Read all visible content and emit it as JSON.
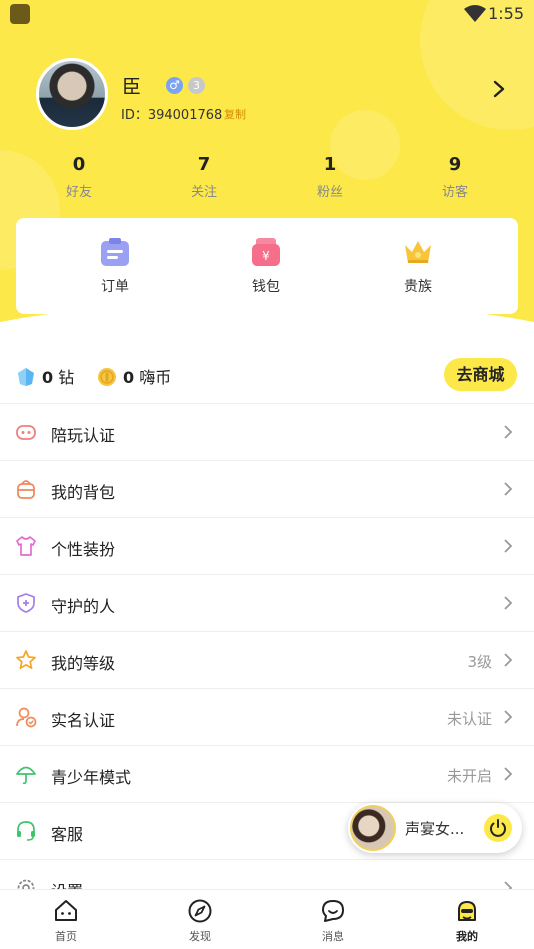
{
  "status_bar": {
    "time": "1:55"
  },
  "profile": {
    "name": "臣",
    "gender_symbol": "♂",
    "level_badge": "3",
    "id_text": "ID：394001768",
    "copy_label": "复制"
  },
  "stats": [
    {
      "value": "0",
      "label": "好友"
    },
    {
      "value": "7",
      "label": "关注"
    },
    {
      "value": "1",
      "label": "粉丝"
    },
    {
      "value": "9",
      "label": "访客"
    }
  ],
  "quick_actions": [
    {
      "label": "订单",
      "icon": "order-icon"
    },
    {
      "label": "钱包",
      "icon": "wallet-icon"
    },
    {
      "label": "贵族",
      "icon": "crown-icon"
    }
  ],
  "currency": {
    "diamond_value": "0",
    "diamond_unit": "钻",
    "coin_value": "0",
    "coin_unit": "嗨币",
    "shop_button": "去商城"
  },
  "menu": [
    {
      "label": "陪玩认证",
      "value": "",
      "icon": "game-partner-icon"
    },
    {
      "label": "我的背包",
      "value": "",
      "icon": "backpack-icon"
    },
    {
      "label": "个性装扮",
      "value": "",
      "icon": "shirt-icon"
    },
    {
      "label": "守护的人",
      "value": "",
      "icon": "shield-icon"
    },
    {
      "label": "我的等级",
      "value": "3级",
      "icon": "star-icon"
    },
    {
      "label": "实名认证",
      "value": "未认证",
      "icon": "verified-user-icon"
    },
    {
      "label": "青少年模式",
      "value": "未开启",
      "icon": "umbrella-icon"
    },
    {
      "label": "客服",
      "value": "",
      "icon": "headset-icon"
    },
    {
      "label": "设置",
      "value": "",
      "icon": "gear-icon"
    }
  ],
  "floating_player": {
    "title": "声宴女..."
  },
  "tabs": [
    {
      "label": "首页",
      "icon": "home-icon"
    },
    {
      "label": "发现",
      "icon": "compass-icon"
    },
    {
      "label": "消息",
      "icon": "message-icon"
    },
    {
      "label": "我的",
      "icon": "profile-icon"
    }
  ],
  "colors": {
    "accent_yellow": "#fde84a",
    "muted_text": "#999999",
    "copy_link": "#d08a00"
  }
}
